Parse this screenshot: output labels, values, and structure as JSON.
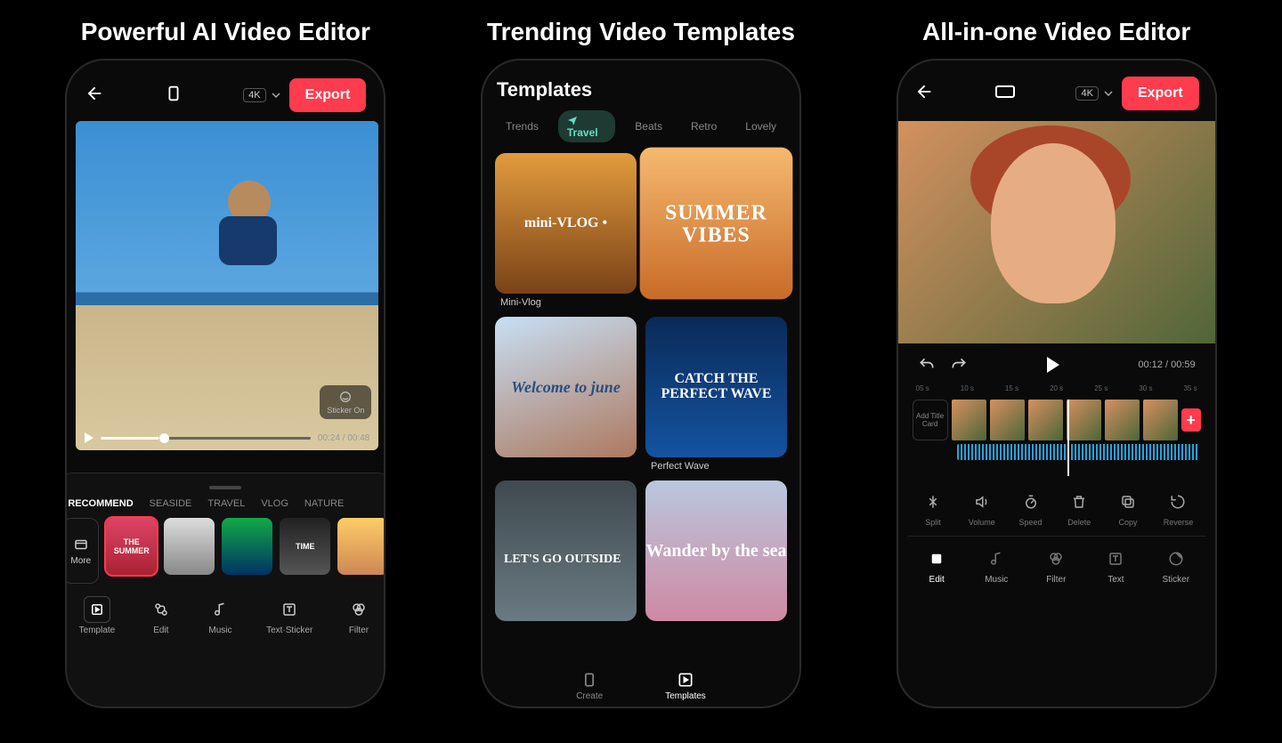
{
  "panel1": {
    "headline": "Powerful AI Video Editor",
    "resolution": "4K",
    "export": "Export",
    "watermark": "Sticker On",
    "time_current": "00:24",
    "time_total": "00:48",
    "tabs": [
      "RECOMMEND",
      "SEASIDE",
      "TRAVEL",
      "VLOG",
      "NATURE"
    ],
    "more": "More",
    "thumbs": [
      "THE SUMMER",
      "",
      "",
      "TIME",
      ""
    ],
    "tools": [
      "Template",
      "Edit",
      "Music",
      "Text·Sticker",
      "Filter"
    ]
  },
  "panel2": {
    "headline": "Trending Video Templates",
    "title": "Templates",
    "categories": [
      "Trends",
      "Travel",
      "Beats",
      "Retro",
      "Lovely"
    ],
    "templates": [
      {
        "name": "Mini-Vlog",
        "overlay": "mini-VLOG •"
      },
      {
        "name": "",
        "overlay": "SUMMER VIBES"
      },
      {
        "name": "",
        "overlay": "Welcome to june"
      },
      {
        "name": "Perfect Wave",
        "overlay": "CATCH THE PERFECT WAVE"
      },
      {
        "name": "",
        "overlay": "LET'S GO OUTSIDE"
      },
      {
        "name": "",
        "overlay": "Wander by the sea"
      }
    ],
    "nav": [
      "Create",
      "Templates"
    ]
  },
  "panel3": {
    "headline": "All-in-one Video Editor",
    "resolution": "4K",
    "export": "Export",
    "time_current": "00:12",
    "time_total": "00:59",
    "ruler": [
      "05 s",
      "10 s",
      "15 s",
      "20 s",
      "25 s",
      "30 s",
      "35 s"
    ],
    "add_card": "Add Title Card",
    "edit_tools": [
      "Split",
      "Volume",
      "Speed",
      "Delete",
      "Copy",
      "Reverse"
    ],
    "main_tabs": [
      "Edit",
      "Music",
      "Filter",
      "Text",
      "Sticker"
    ]
  }
}
